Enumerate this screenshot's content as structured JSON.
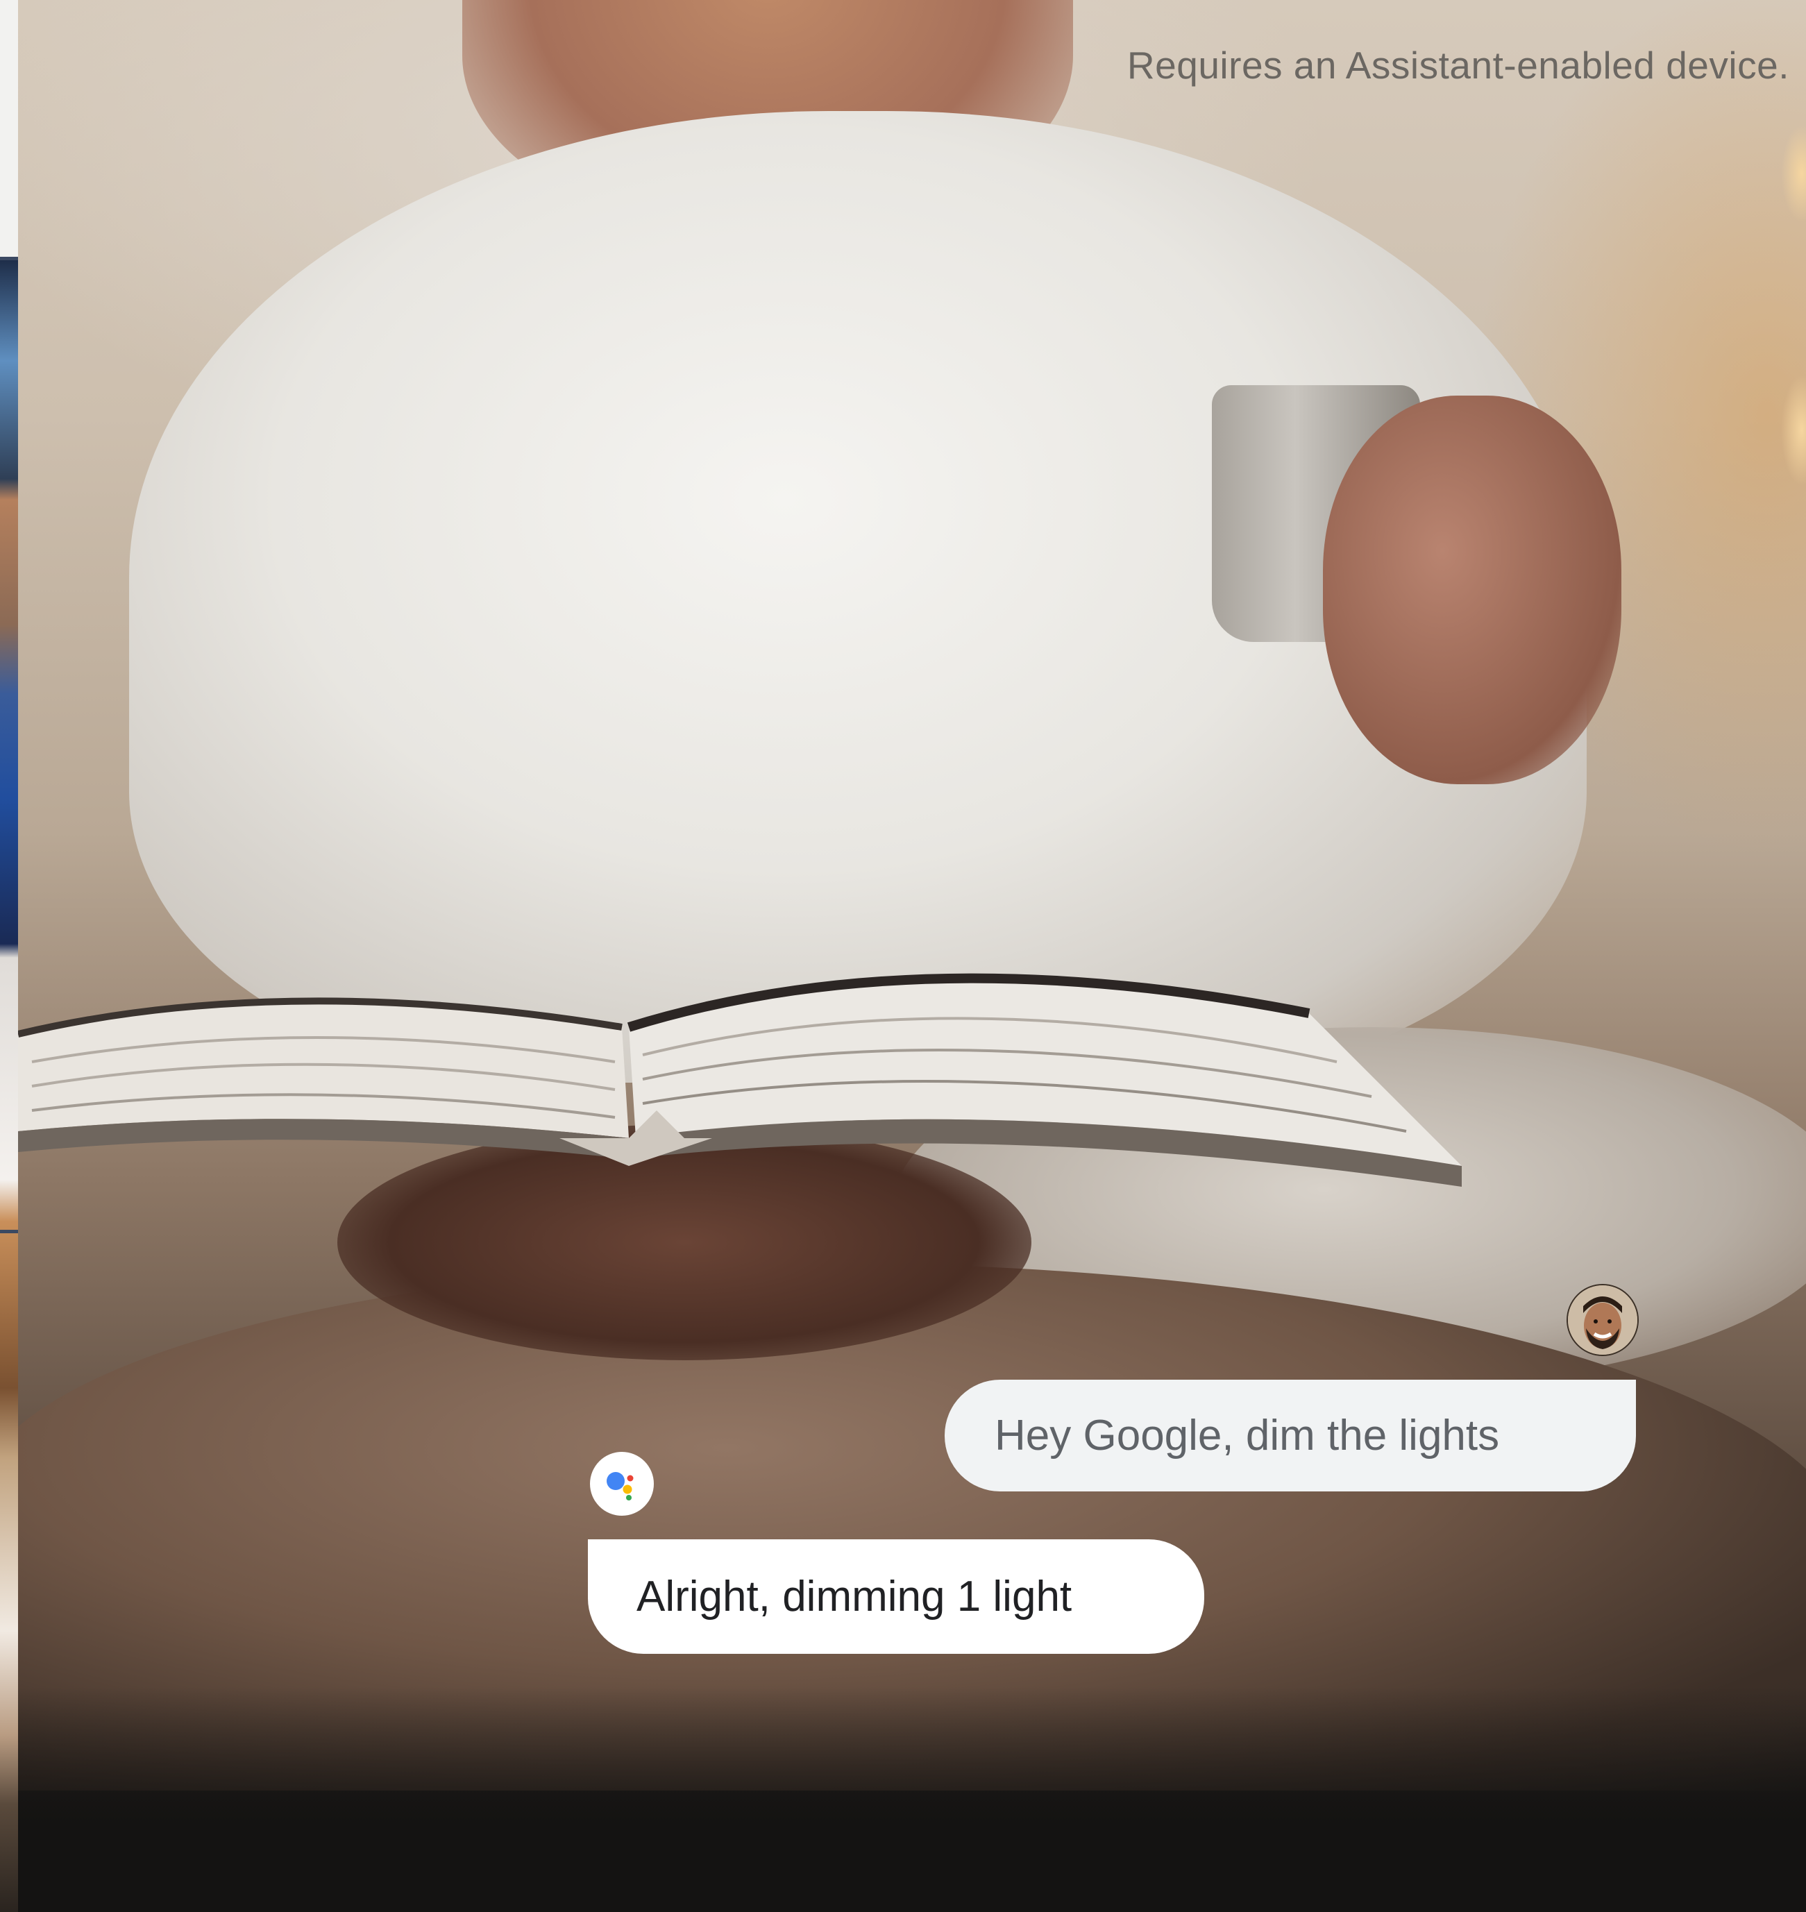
{
  "disclaimer": "Requires an Assistant-enabled device.",
  "conversation": {
    "user": {
      "avatar_icon": "user-avatar-photo",
      "text": "Hey Google, dim the lights"
    },
    "assistant": {
      "icon": "google-assistant-icon",
      "text": "Alright, dimming 1 light"
    }
  },
  "colors": {
    "user_bubble": "#f1f3f4",
    "user_text": "#5f6368",
    "assistant_bubble": "#ffffff",
    "assistant_text": "#202124",
    "assistant_blue": "#4285f4",
    "assistant_red": "#ea4335",
    "assistant_yellow": "#fbbc05",
    "assistant_green": "#34a853"
  }
}
